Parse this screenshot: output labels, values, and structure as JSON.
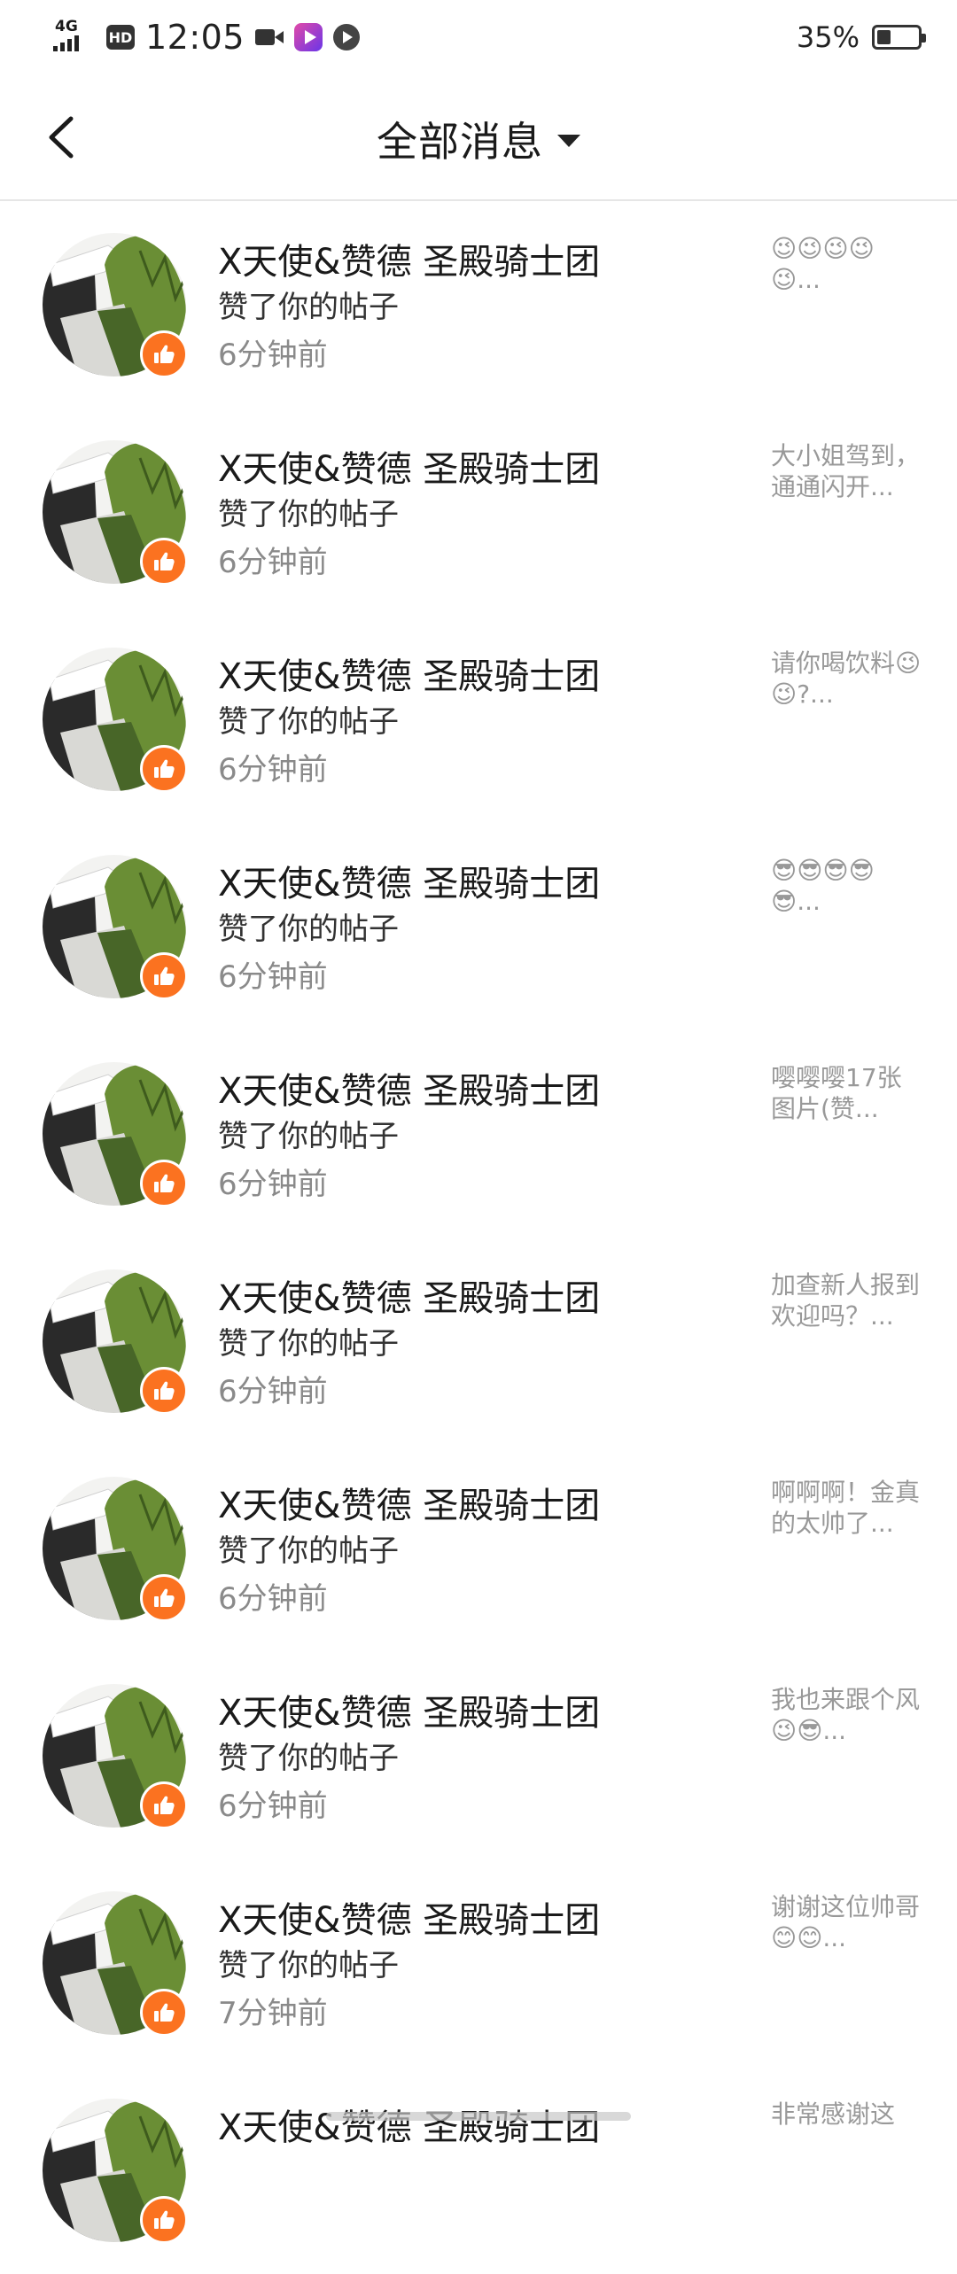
{
  "status_bar": {
    "network": "4G",
    "hd": "HD",
    "time": "12:05",
    "battery_text": "35%",
    "battery_level": 0.35,
    "icons": [
      "signal-icon",
      "hd-icon",
      "video-camera-icon",
      "app-icon",
      "play-icon",
      "battery-icon"
    ]
  },
  "header": {
    "title": "全部消息",
    "back_icon": "chevron-left-icon",
    "dropdown_icon": "caret-down-icon"
  },
  "messages": [
    {
      "name": "X天使&赞德 圣殿骑士团",
      "action": "赞了你的帖子",
      "time": "6分钟前",
      "preview": "😉😉😉😉😉..."
    },
    {
      "name": "X天使&赞德 圣殿骑士团",
      "action": "赞了你的帖子",
      "time": "6分钟前",
      "preview": "大小姐驾到，通通闪开..."
    },
    {
      "name": "X天使&赞德 圣殿骑士团",
      "action": "赞了你的帖子",
      "time": "6分钟前",
      "preview": "请你喝饮料😉😉?..."
    },
    {
      "name": "X天使&赞德 圣殿骑士团",
      "action": "赞了你的帖子",
      "time": "6分钟前",
      "preview": "😎😎😎😎😎..."
    },
    {
      "name": "X天使&赞德 圣殿骑士团",
      "action": "赞了你的帖子",
      "time": "6分钟前",
      "preview": "嘤嘤嘤17张图片(赞..."
    },
    {
      "name": "X天使&赞德 圣殿骑士团",
      "action": "赞了你的帖子",
      "time": "6分钟前",
      "preview": "加查新人报到欢迎吗？..."
    },
    {
      "name": "X天使&赞德 圣殿骑士团",
      "action": "赞了你的帖子",
      "time": "6分钟前",
      "preview": "啊啊啊！金真的太帅了..."
    },
    {
      "name": "X天使&赞德 圣殿骑士团",
      "action": "赞了你的帖子",
      "time": "6分钟前",
      "preview": "我也来跟个风😉😎..."
    },
    {
      "name": "X天使&赞德 圣殿骑士团",
      "action": "赞了你的帖子",
      "time": "7分钟前",
      "preview": "谢谢这位帅哥😊😊..."
    },
    {
      "name": "X天使&赞德 圣殿骑士团",
      "action": "",
      "time": "",
      "preview": "非常感谢这"
    }
  ],
  "colors": {
    "like_badge": "#fb7220",
    "preview_text": "#999999",
    "time_text": "#8a8a8a",
    "divider": "#e6e6e6"
  }
}
